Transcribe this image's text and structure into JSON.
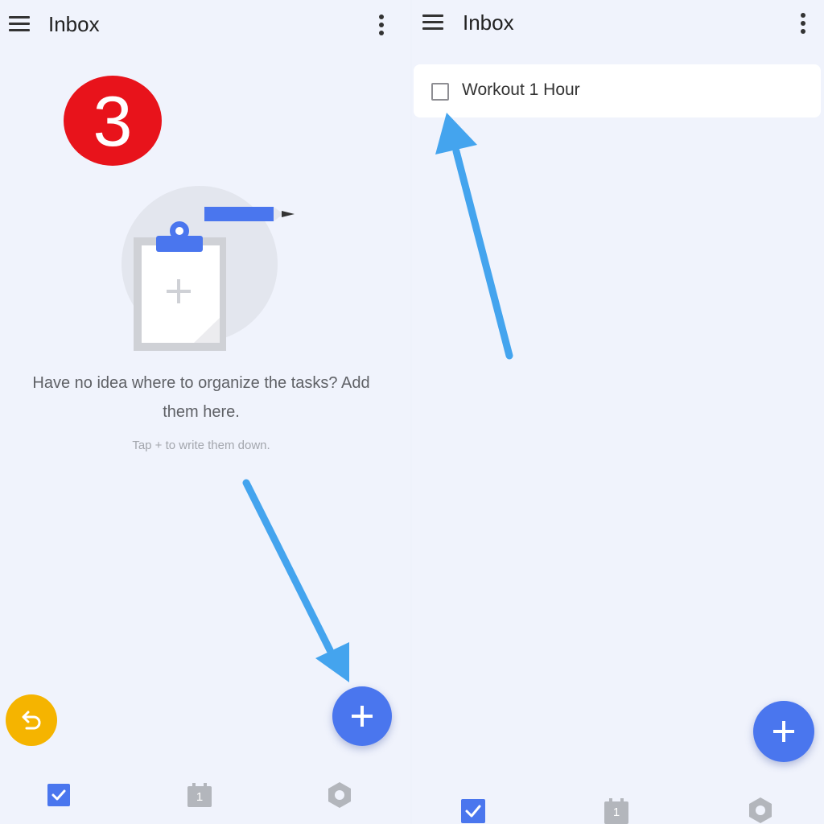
{
  "left": {
    "header": {
      "title": "Inbox"
    },
    "step_badge": "3",
    "empty_state": {
      "message": "Have no idea where to organize the tasks? Add them here.",
      "hint": "Tap + to write them down."
    },
    "bottom_tabs": {
      "calendar_day": "1"
    }
  },
  "right": {
    "header": {
      "title": "Inbox"
    },
    "tasks": [
      {
        "title": "Workout 1 Hour",
        "checked": false
      }
    ],
    "bottom_tabs": {
      "calendar_day": "1"
    }
  },
  "colors": {
    "accent": "#4a76ee",
    "badge": "#e8131b",
    "annotation_arrow": "#44a4ee",
    "undo": "#f5b400",
    "background": "#f0f3fc"
  },
  "icons": [
    "menu-icon",
    "more-vertical-icon",
    "plus-icon",
    "undo-icon",
    "task-tab-icon",
    "calendar-tab-icon",
    "settings-tab-icon",
    "clipboard-illustration",
    "pencil-illustration"
  ]
}
